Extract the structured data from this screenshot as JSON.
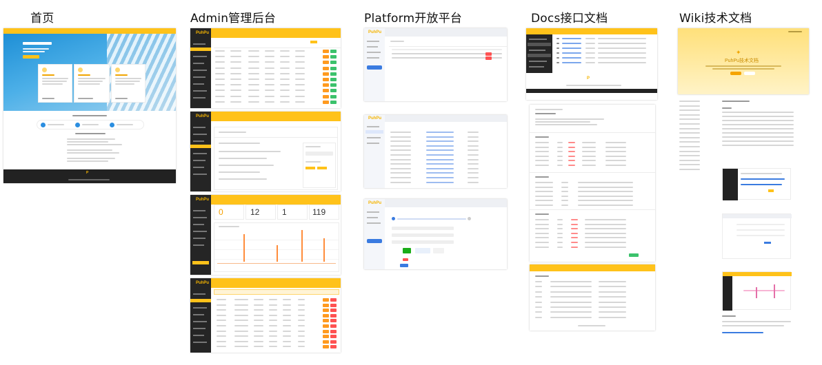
{
  "columns": [
    {
      "id": "home",
      "title": "首页"
    },
    {
      "id": "admin",
      "title": "Admin管理后台"
    },
    {
      "id": "platform",
      "title": "Platform开放平台"
    },
    {
      "id": "docs",
      "title": "Docs接口文档"
    },
    {
      "id": "wiki",
      "title": "Wiki技术文档"
    }
  ],
  "dashboard_stats": [
    "0",
    "12",
    "1",
    "119"
  ],
  "wiki_heading": "PuhPu技术文档",
  "colors": {
    "accent": "#ffc21a",
    "dark": "#222222",
    "orange": "#ff9a1f",
    "green": "#3cc26c",
    "red": "#ff5252"
  }
}
